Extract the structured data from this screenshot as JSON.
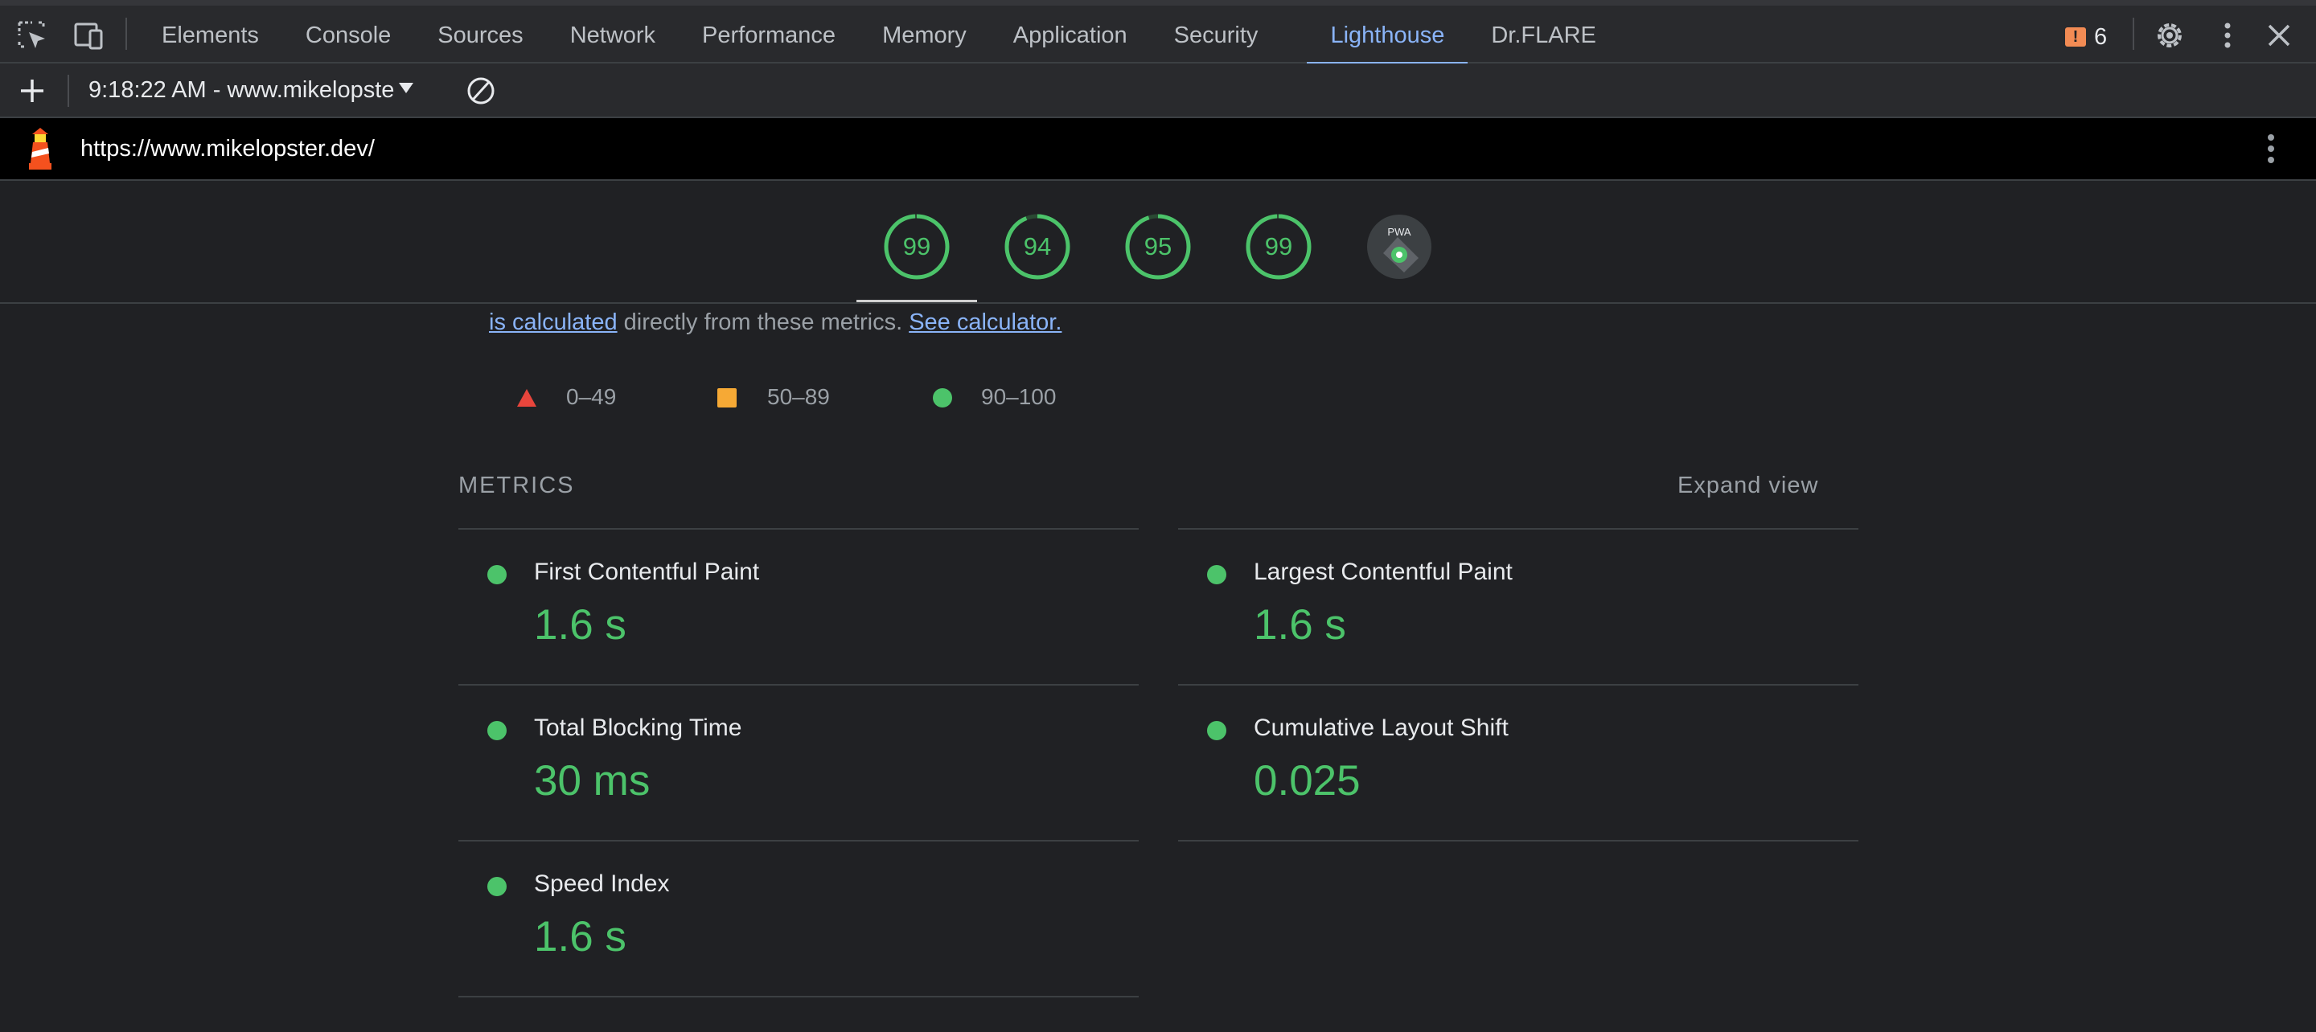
{
  "devtools": {
    "tabs": [
      {
        "label": "Elements",
        "active": false
      },
      {
        "label": "Console",
        "active": false
      },
      {
        "label": "Sources",
        "active": false
      },
      {
        "label": "Network",
        "active": false
      },
      {
        "label": "Performance",
        "active": false
      },
      {
        "label": "Memory",
        "active": false
      },
      {
        "label": "Application",
        "active": false
      },
      {
        "label": "Security",
        "active": false
      },
      {
        "label": "Lighthouse",
        "active": true
      },
      {
        "label": "Dr.FLARE",
        "active": false
      }
    ],
    "issues_count": "6",
    "issues_badge": "!"
  },
  "lighthouse_toolbar": {
    "report_label": "9:18:22 AM - www.mikelopste"
  },
  "url_bar": {
    "url": "https://www.mikelopster.dev/"
  },
  "scores": [
    {
      "name": "performance",
      "value": "99",
      "fraction": 0.99
    },
    {
      "name": "accessibility",
      "value": "94",
      "fraction": 0.94
    },
    {
      "name": "best-practices",
      "value": "95",
      "fraction": 0.95
    },
    {
      "name": "seo",
      "value": "99",
      "fraction": 0.99
    }
  ],
  "pwa_label": "PWA",
  "intro": {
    "link1": "is calculated",
    "middle": " directly from these metrics. ",
    "link2": "See calculator."
  },
  "legend": {
    "fail": "0–49",
    "average": "50–89",
    "pass": "90–100"
  },
  "metrics_section": {
    "title": "METRICS",
    "expand_label": "Expand view",
    "items": [
      {
        "title": "First Contentful Paint",
        "value": "1.6 s"
      },
      {
        "title": "Largest Contentful Paint",
        "value": "1.6 s"
      },
      {
        "title": "Total Blocking Time",
        "value": "30 ms"
      },
      {
        "title": "Cumulative Layout Shift",
        "value": "0.025"
      },
      {
        "title": "Speed Index",
        "value": "1.6 s"
      }
    ]
  },
  "colors": {
    "pass": "#4cc36a",
    "average": "#f6a935",
    "fail": "#e8453c",
    "accent": "#8ab4f8"
  }
}
